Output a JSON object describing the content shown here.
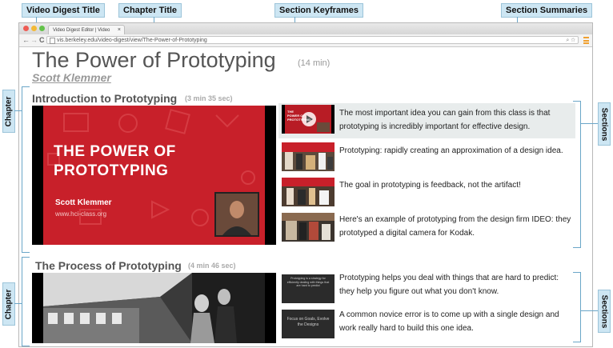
{
  "callouts": {
    "video_digest_title": "Video Digest Title",
    "chapter_title": "Chapter Title",
    "section_keyframes": "Section Keyframes",
    "section_summaries": "Section Summaries",
    "chapter": "Chapter",
    "sections": "Sections"
  },
  "browser": {
    "tab_title": "Video Digest Editor | Video",
    "tab_close": "×",
    "url": "vis.berkeley.edu/video-digest/view/The-Power-of-Prototyping",
    "back": "←",
    "forward": "→",
    "reload": "C",
    "url_right_icons": "⌕ ☆"
  },
  "video": {
    "title": "The Power of Prototyping",
    "duration": "(14 min)",
    "author": "Scott Klemmer"
  },
  "chapters": [
    {
      "title": "Introduction to Prototyping",
      "duration": "(3 min 35 sec)",
      "slide": {
        "line1": "THE POWER OF",
        "line2": "PROTOTYPING",
        "presenter": "Scott Klemmer",
        "site": "www.hci-class.org"
      },
      "sections": [
        {
          "summary": "The most important idea you can gain from this class is that prototyping is incredibly important for effective design.",
          "keyframe_text": "THE POWER OF PROTOTYPING"
        },
        {
          "summary": "Prototyping: rapidly creating an approximation of a design idea."
        },
        {
          "summary": "The goal in prototyping is feedback, not the artifact!"
        },
        {
          "summary": "Here's an example of prototyping from the design firm IDEO: they prototyped a digital camera for Kodak."
        }
      ]
    },
    {
      "title": "The Process of Prototyping",
      "duration": "(4 min 46 sec)",
      "sections": [
        {
          "summary": "Prototyping helps you deal with things that are hard to predict: they help you figure out what you don't know.",
          "keyframe_text": "Prototyping is a strategy for efficiently dealing with things that are hard to predict"
        },
        {
          "summary": "A common novice error is to come up with a single design and work really hard to build this one idea.",
          "keyframe_text": "Focus on Goals, Evolve the Designs"
        }
      ]
    }
  ],
  "colors": {
    "callout_bg": "#cde6f3",
    "slide_red": "#c8202a",
    "highlight_bg": "#e8ecec"
  }
}
